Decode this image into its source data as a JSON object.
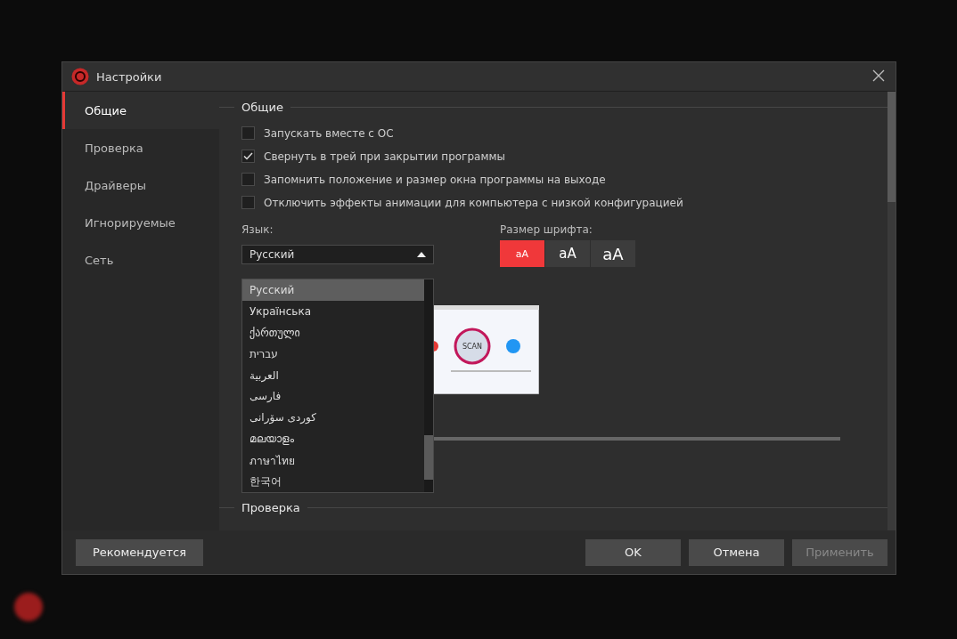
{
  "dialog": {
    "title": "Настройки"
  },
  "sidebar": {
    "items": [
      {
        "label": "Общие",
        "selected": true
      },
      {
        "label": "Проверка",
        "selected": false
      },
      {
        "label": "Драйверы",
        "selected": false
      },
      {
        "label": "Игнорируемые",
        "selected": false
      },
      {
        "label": "Сеть",
        "selected": false
      }
    ]
  },
  "general": {
    "heading": "Общие",
    "options": [
      {
        "label": "Запускать вместе с ОС",
        "checked": false
      },
      {
        "label": "Свернуть в трей при закрытии программы",
        "checked": true
      },
      {
        "label": "Запомнить положение и размер окна программы на выходе",
        "checked": false
      },
      {
        "label": "Отключить эффекты анимации для компьютера с низкой конфигурацией",
        "checked": false
      }
    ],
    "language": {
      "label": "Язык:",
      "value": "Русский",
      "expanded": true,
      "options": [
        {
          "label": "Русский",
          "selected": true
        },
        {
          "label": "Українська",
          "selected": false
        },
        {
          "label": "ქართული",
          "selected": false
        },
        {
          "label": "עברית",
          "selected": false
        },
        {
          "label": "العربية",
          "selected": false
        },
        {
          "label": "فارسی",
          "selected": false
        },
        {
          "label": "کوردی سۆرانی",
          "selected": false
        },
        {
          "label": "മലയാളം",
          "selected": false
        },
        {
          "label": "ภาษาไทย",
          "selected": false
        },
        {
          "label": "한국어",
          "selected": false
        }
      ]
    },
    "font_size": {
      "label": "Размер шрифта:",
      "options": [
        {
          "label": "aA",
          "selected": true
        },
        {
          "label": "aA",
          "selected": false
        },
        {
          "label": "aA",
          "selected": false
        }
      ]
    },
    "preview": {
      "scan_label": "SCAN"
    }
  },
  "next_section": {
    "heading": "Проверка"
  },
  "buttons": [
    {
      "label": "Рекомендуется",
      "disabled": false
    },
    {
      "label": "OK",
      "disabled": false
    },
    {
      "label": "Отмена",
      "disabled": false
    },
    {
      "label": "Применить",
      "disabled": true
    }
  ]
}
